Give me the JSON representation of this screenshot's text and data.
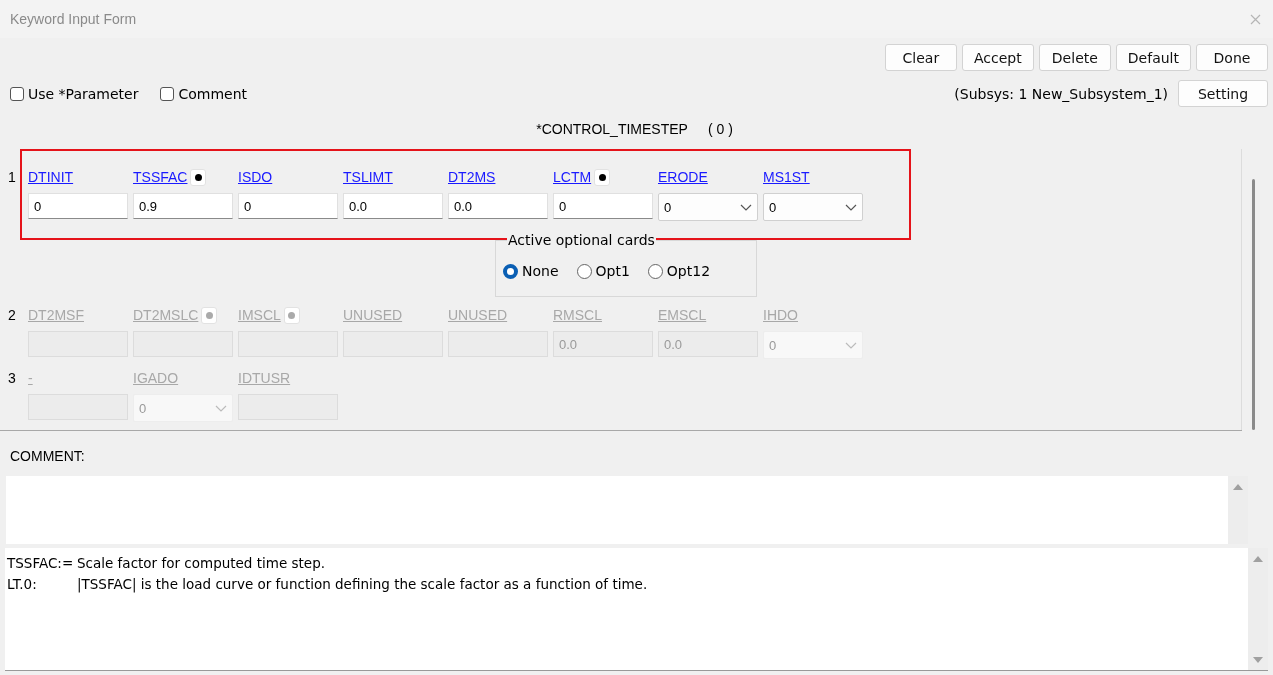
{
  "window": {
    "title": "Keyword Input Form"
  },
  "buttons": [
    "Clear",
    "Accept",
    "Delete",
    "Default",
    "Done"
  ],
  "options": [
    {
      "label": "Use *Parameter",
      "checked": false
    },
    {
      "label": "Comment",
      "checked": false
    }
  ],
  "subsystem": "(Subsys: 1 New_Subsystem_1)",
  "setting_button": "Setting",
  "keyword": {
    "name": "*CONTROL_TIMESTEP",
    "count": "( 0 )"
  },
  "cards": [
    {
      "number": "1",
      "enabled": true,
      "highlighted": true,
      "fields": [
        {
          "label": "DTINIT",
          "kind": "text",
          "value": "0",
          "dot": false
        },
        {
          "label": "TSSFAC",
          "kind": "text",
          "value": "0.9",
          "dot": true
        },
        {
          "label": "ISDO",
          "kind": "text",
          "value": "0",
          "dot": false
        },
        {
          "label": "TSLIMT",
          "kind": "text",
          "value": "0.0",
          "dot": false
        },
        {
          "label": "DT2MS",
          "kind": "text",
          "value": "0.0",
          "dot": false
        },
        {
          "label": "LCTM",
          "kind": "text",
          "value": "0",
          "dot": true
        },
        {
          "label": "ERODE",
          "kind": "select",
          "value": "0",
          "dot": false
        },
        {
          "label": "MS1ST",
          "kind": "select",
          "value": "0",
          "dot": false
        }
      ]
    },
    {
      "number": "2",
      "enabled": false,
      "highlighted": false,
      "fields": [
        {
          "label": "DT2MSF",
          "kind": "text",
          "dot": false
        },
        {
          "label": "DT2MSLC",
          "kind": "text",
          "dot": true
        },
        {
          "label": "IMSCL",
          "kind": "text",
          "dot": true
        },
        {
          "label": "UNUSED",
          "kind": "text",
          "dot": false
        },
        {
          "label": "UNUSED",
          "kind": "text",
          "dot": false
        },
        {
          "label": "RMSCL",
          "kind": "text",
          "value": "0.0",
          "dot": false
        },
        {
          "label": "EMSCL",
          "kind": "text",
          "value": "0.0",
          "dot": false
        },
        {
          "label": "IHDO",
          "kind": "select",
          "value": "0",
          "dot": false
        }
      ]
    },
    {
      "number": "3",
      "enabled": false,
      "highlighted": false,
      "fields": [
        {
          "label": "-",
          "kind": "text",
          "dot": false
        },
        {
          "label": "IGADO",
          "kind": "select",
          "value": "0",
          "dot": false
        },
        {
          "label": "IDTUSR",
          "kind": "text",
          "dot": false
        }
      ]
    }
  ],
  "optional_cards": {
    "title": "Active optional cards",
    "choices": [
      {
        "label": "None",
        "selected": true
      },
      {
        "label": "Opt1",
        "selected": false
      },
      {
        "label": "Opt12",
        "selected": false
      }
    ]
  },
  "comment": {
    "label": "COMMENT:"
  },
  "help": [
    {
      "term": "TSSFAC:=",
      "text": "Scale factor for computed time step."
    },
    {
      "term": "LT.0:",
      "text": "|TSSFAC| is the load curve or function defining the scale factor as a function of time."
    }
  ]
}
